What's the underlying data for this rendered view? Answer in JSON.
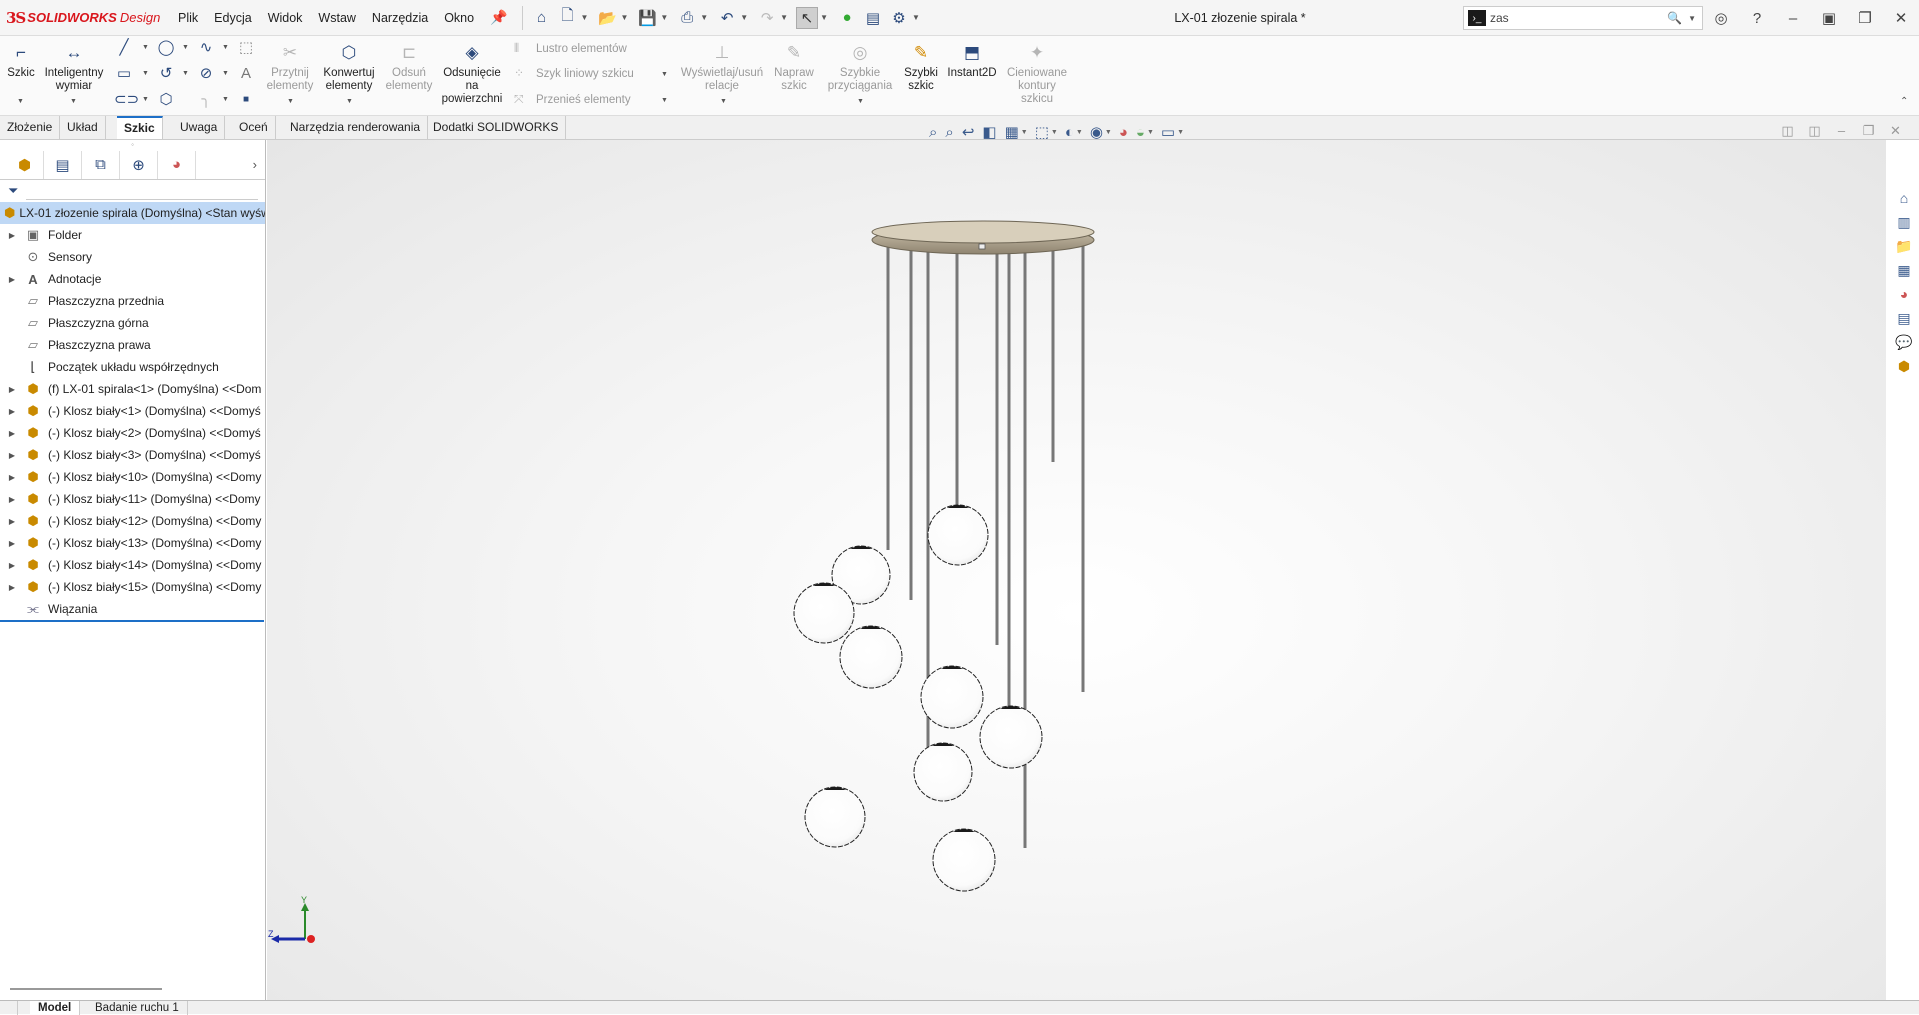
{
  "app": {
    "brand_ds": "3S",
    "brand_name": "SOLIDWORKS",
    "brand_suffix": "Design",
    "document_title": "LX-01 złozenie spirala *"
  },
  "menu": [
    "Plik",
    "Edycja",
    "Widok",
    "Wstaw",
    "Narzędzia",
    "Okno"
  ],
  "search": {
    "value": "zas"
  },
  "ribbon": {
    "szkic": "Szkic",
    "inteligentny_wymiar": "Inteligentny wymiar",
    "przytnij": "Przytnij elementy",
    "konwertuj": "Konwertuj elementy",
    "odsun": "Odsuń elementy",
    "odsuniecie": "Odsunięcie na powierzchni",
    "lustro": "Lustro elementów",
    "szyk": "Szyk liniowy szkicu",
    "przenies": "Przenieś elementy",
    "wyswietlaj": "Wyświetlaj/usuń relacje",
    "napraw": "Napraw szkic",
    "szybkie_przyciaganie": "Szybkie przyciągania",
    "szybki_szkic": "Szybki szkic",
    "instant2d": "Instant2D",
    "cieniowane": "Cieniowane kontury szkicu"
  },
  "command_tabs": [
    {
      "label": "Złożenie",
      "active": false
    },
    {
      "label": "Układ",
      "active": false
    },
    {
      "label": "Szkic",
      "active": true
    },
    {
      "label": "Uwaga",
      "active": false
    },
    {
      "label": "Oceń",
      "active": false
    },
    {
      "label": "Narzędzia renderowania",
      "active": false
    },
    {
      "label": "Dodatki SOLIDWORKS",
      "active": false
    }
  ],
  "tree": {
    "root": "LX-01 złozenie spirala (Domyślna) <Stan wyśw",
    "items": [
      {
        "label": "Folder",
        "icon": "history-folder-icon",
        "expandable": true
      },
      {
        "label": "Sensory",
        "icon": "sensor-icon",
        "expandable": false
      },
      {
        "label": "Adnotacje",
        "icon": "annotation-icon",
        "expandable": true
      },
      {
        "label": "Płaszczyzna przednia",
        "icon": "plane-icon",
        "expandable": false
      },
      {
        "label": "Płaszczyzna górna",
        "icon": "plane-icon",
        "expandable": false
      },
      {
        "label": "Płaszczyzna prawa",
        "icon": "plane-icon",
        "expandable": false
      },
      {
        "label": "Początek układu współrzędnych",
        "icon": "origin-icon",
        "expandable": false
      },
      {
        "label": "(f) LX-01 spirala<1> (Domyślna) <<Dom",
        "icon": "part-icon",
        "expandable": true
      },
      {
        "label": "(-) Klosz biały<1> (Domyślna) <<Domyś",
        "icon": "part-icon",
        "expandable": true
      },
      {
        "label": "(-) Klosz biały<2> (Domyślna) <<Domyś",
        "icon": "part-icon",
        "expandable": true
      },
      {
        "label": "(-) Klosz biały<3> (Domyślna) <<Domyś",
        "icon": "part-icon",
        "expandable": true
      },
      {
        "label": "(-) Klosz biały<10> (Domyślna) <<Domy",
        "icon": "part-icon",
        "expandable": true
      },
      {
        "label": "(-) Klosz biały<11> (Domyślna) <<Domy",
        "icon": "part-icon",
        "expandable": true
      },
      {
        "label": "(-) Klosz biały<12> (Domyślna) <<Domy",
        "icon": "part-icon",
        "expandable": true
      },
      {
        "label": "(-) Klosz biały<13> (Domyślna) <<Domy",
        "icon": "part-icon",
        "expandable": true
      },
      {
        "label": "(-) Klosz biały<14> (Domyślna) <<Domy",
        "icon": "part-icon",
        "expandable": true
      },
      {
        "label": "(-) Klosz biały<15> (Domyślna) <<Domy",
        "icon": "part-icon",
        "expandable": true
      },
      {
        "label": "Wiązania",
        "icon": "mates-icon",
        "expandable": false
      }
    ]
  },
  "triad": {
    "y": "Y",
    "z": "Z"
  },
  "bottom_tabs": [
    {
      "label": "Model",
      "active": true
    },
    {
      "label": "Badanie ruchu 1",
      "active": false
    }
  ]
}
